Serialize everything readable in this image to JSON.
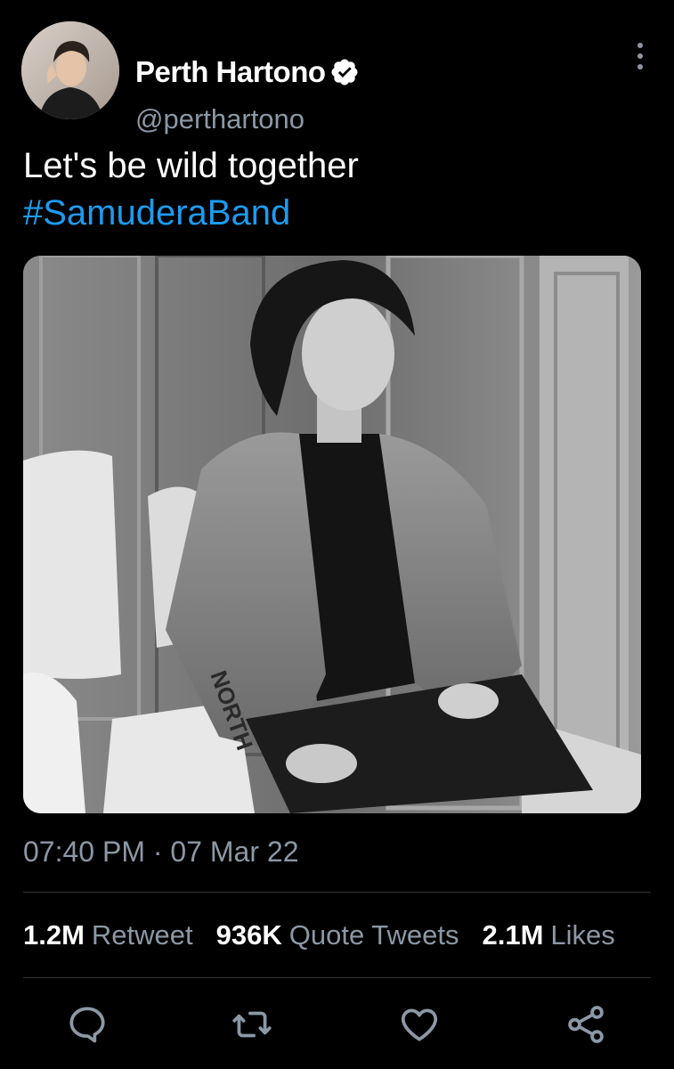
{
  "user": {
    "display_name": "Perth Hartono",
    "handle": "@perthartono",
    "verified": true
  },
  "tweet": {
    "text": "Let's be wild together",
    "hashtag": "#SamuderaBand",
    "timestamp": "07:40 PM · 07 Mar 22"
  },
  "stats": {
    "retweets": {
      "value": "1.2M",
      "label": "Retweet"
    },
    "quote_tweets": {
      "value": "936K",
      "label": "Quote Tweets"
    },
    "likes": {
      "value": "2.1M",
      "label": "Likes"
    }
  },
  "icons": {
    "more": "more-vertical-icon",
    "reply": "reply-icon",
    "retweet": "retweet-icon",
    "like": "heart-icon",
    "share": "share-icon",
    "verified": "verified-badge-icon"
  },
  "colors": {
    "background": "#000000",
    "accent": "#1d9bf0",
    "secondary_text": "#8b98a5",
    "divider": "#2f3336"
  }
}
